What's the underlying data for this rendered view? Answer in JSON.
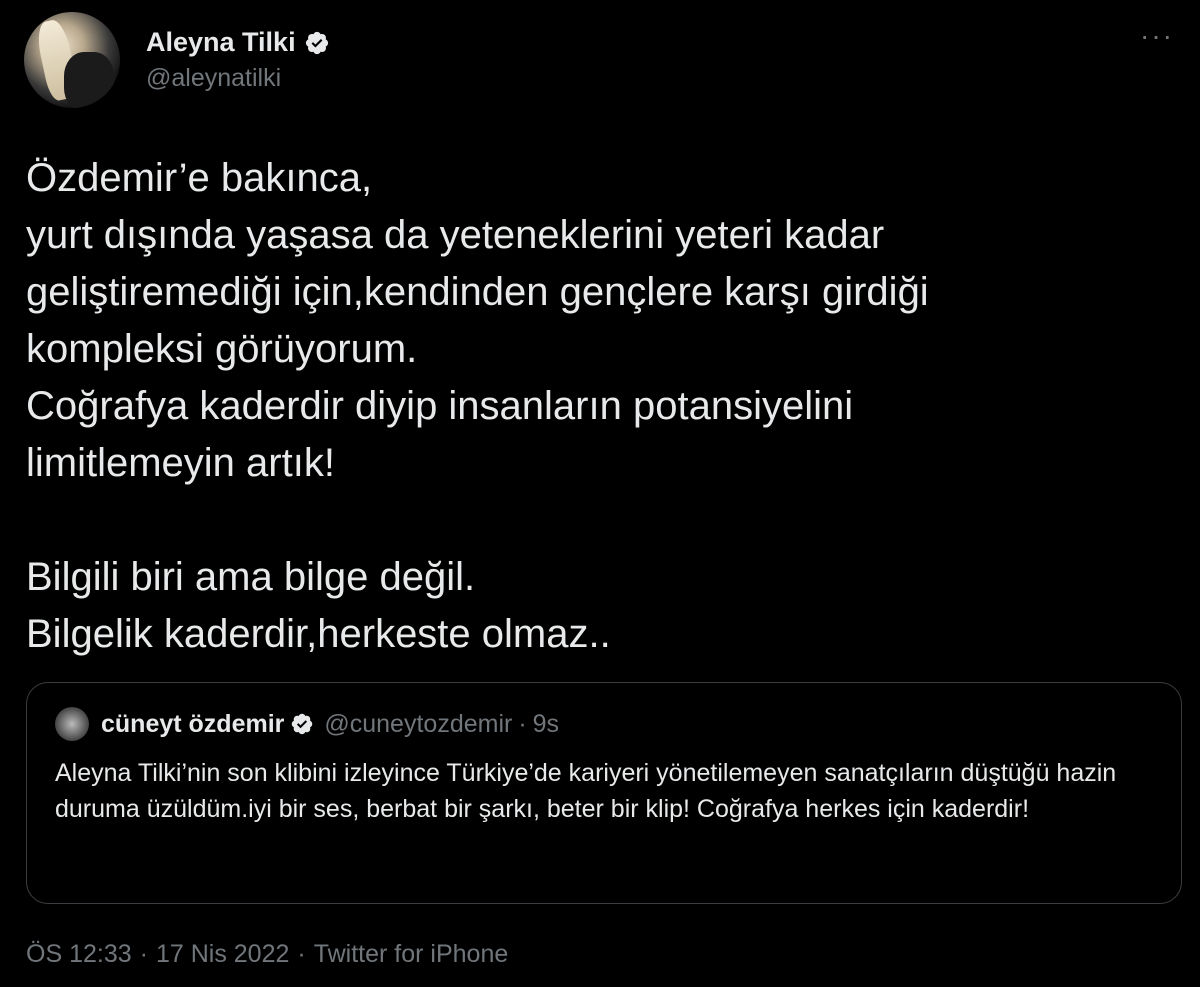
{
  "author": {
    "display_name": "Aleyna Tilki",
    "handle": "@aleynatilki",
    "verified_icon": "verified-badge-icon"
  },
  "more_icon": "more-horizontal-icon",
  "tweet": {
    "lines": [
      "Özdemir’e bakınca,",
      "yurt dışında yaşasa da yeteneklerini yeteri kadar",
      "geliştiremediği için,kendinden gençlere karşı girdiği",
      "kompleksi görüyorum.",
      "Coğrafya kaderdir diyip insanların potansiyelini",
      "limitlemeyin artık!"
    ],
    "lines2": [
      "Bilgili biri ama bilge değil.",
      "Bilgelik kaderdir,herkeste olmaz.."
    ]
  },
  "quote": {
    "display_name": "cüneyt özdemir",
    "handle": "@cuneytozdemir",
    "separator": "·",
    "time": "9s",
    "text": "Aleyna Tilki’nin son klibini izleyince Türkiye’de kariyeri yönetilemeyen sanatçıların düştüğü hazin duruma üzüldüm.iyi bir ses, berbat bir şarkı, beter bir klip! Coğrafya herkes için kaderdir!"
  },
  "meta": {
    "time": "ÖS 12:33",
    "separator": "·",
    "date": "17 Nis 2022",
    "source": "Twitter for iPhone"
  },
  "colors": {
    "background": "#000000",
    "text": "#e7e9ea",
    "muted": "#71767b",
    "border": "#3a3d41"
  }
}
